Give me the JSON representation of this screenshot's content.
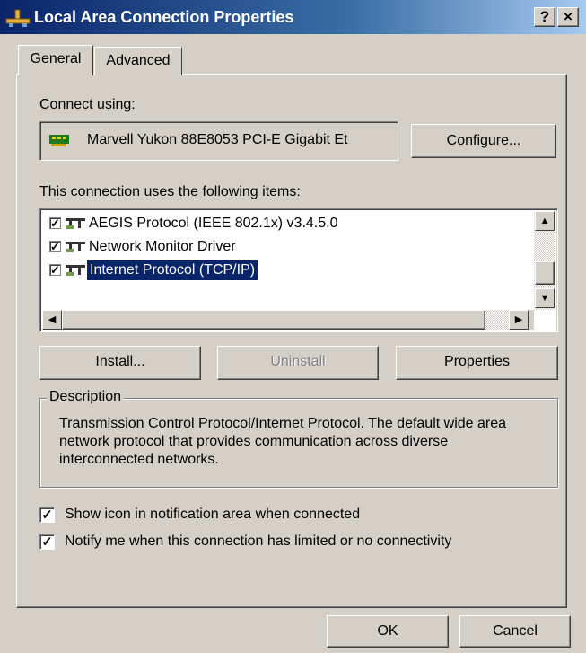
{
  "window": {
    "title": "Local Area Connection Properties",
    "help_button": "?",
    "close_button": "×",
    "title_bar_color": "#0a246a"
  },
  "tabs": [
    {
      "label": "General",
      "active": true
    },
    {
      "label": "Advanced",
      "active": false
    }
  ],
  "connect_using": {
    "label": "Connect using:",
    "adapter_name": "Marvell Yukon 88E8053 PCI-E Gigabit Et",
    "adapter_icon": "network-card-icon",
    "configure_button": "Configure..."
  },
  "items_section": {
    "label": "This connection uses the following items:",
    "items": [
      {
        "label": "AEGIS Protocol (IEEE 802.1x) v3.4.5.0",
        "checked": true,
        "selected": false,
        "icon": "network-protocol-icon"
      },
      {
        "label": "Network Monitor Driver",
        "checked": true,
        "selected": false,
        "icon": "network-protocol-icon"
      },
      {
        "label": "Internet Protocol (TCP/IP)",
        "checked": true,
        "selected": true,
        "icon": "network-protocol-icon"
      }
    ],
    "selection_color": "#0a246a"
  },
  "buttons": {
    "install": "Install...",
    "uninstall": "Uninstall",
    "properties": "Properties"
  },
  "description": {
    "legend": "Description",
    "text": "Transmission Control Protocol/Internet Protocol. The default wide area network protocol that provides communication across diverse interconnected networks."
  },
  "options": {
    "show_icon": {
      "label": "Show icon in notification area when connected",
      "checked": true
    },
    "notify": {
      "label": "Notify me when this connection has limited or no connectivity",
      "checked": true
    }
  },
  "footer": {
    "ok": "OK",
    "cancel": "Cancel"
  }
}
